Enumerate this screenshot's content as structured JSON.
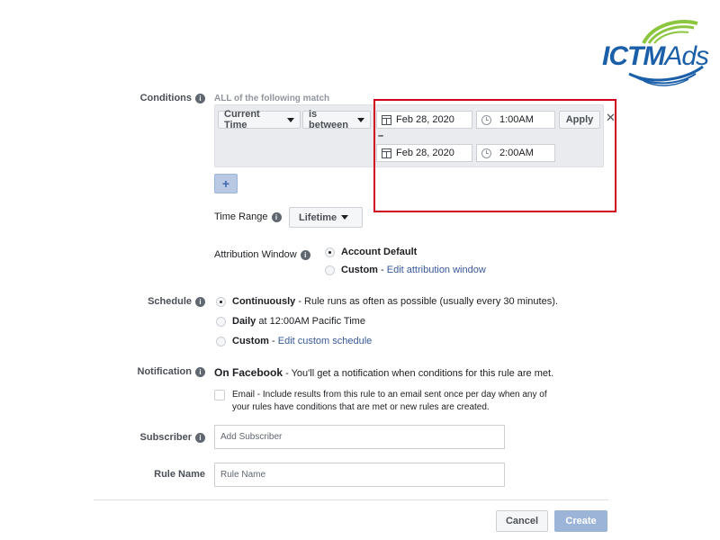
{
  "logo": {
    "part1": "ICTM",
    "part2": "Ads"
  },
  "conditions": {
    "label": "Conditions",
    "sub": "ALL of the following match",
    "field_dropdown": "Current Time",
    "operator_dropdown": "is between",
    "start_date": "Feb 28, 2020",
    "start_time": "1:00AM",
    "separator": "–",
    "end_date": "Feb 28, 2020",
    "end_time": "2:00AM",
    "apply_label": "Apply",
    "close_glyph": "✕",
    "add_glyph": "+"
  },
  "time_range": {
    "label": "Time Range",
    "value": "Lifetime"
  },
  "attribution": {
    "label": "Attribution Window",
    "options": [
      {
        "label": "Account Default",
        "checked": true
      },
      {
        "label": "Custom",
        "link": "Edit attribution window",
        "checked": false
      }
    ]
  },
  "schedule": {
    "label": "Schedule",
    "options": [
      {
        "label": "Continuously",
        "desc": " - Rule runs as often as possible (usually every 30 minutes).",
        "checked": true
      },
      {
        "label": "Daily",
        "desc": " at 12:00AM Pacific Time",
        "checked": false
      },
      {
        "label": "Custom",
        "link": "Edit custom schedule",
        "checked": false
      }
    ]
  },
  "notification": {
    "label": "Notification",
    "title": "On Facebook",
    "desc": " - You'll get a notification when conditions for this rule are met.",
    "email_line1": "Email - Include results from this rule to an email sent once per day when any of",
    "email_line2": "your rules have conditions that are met or new rules are created."
  },
  "subscriber": {
    "label": "Subscriber",
    "placeholder": "Add Subscriber"
  },
  "rule_name": {
    "label": "Rule Name",
    "placeholder": "Rule Name"
  },
  "footer": {
    "cancel_label": "Cancel",
    "create_label": "Create"
  }
}
